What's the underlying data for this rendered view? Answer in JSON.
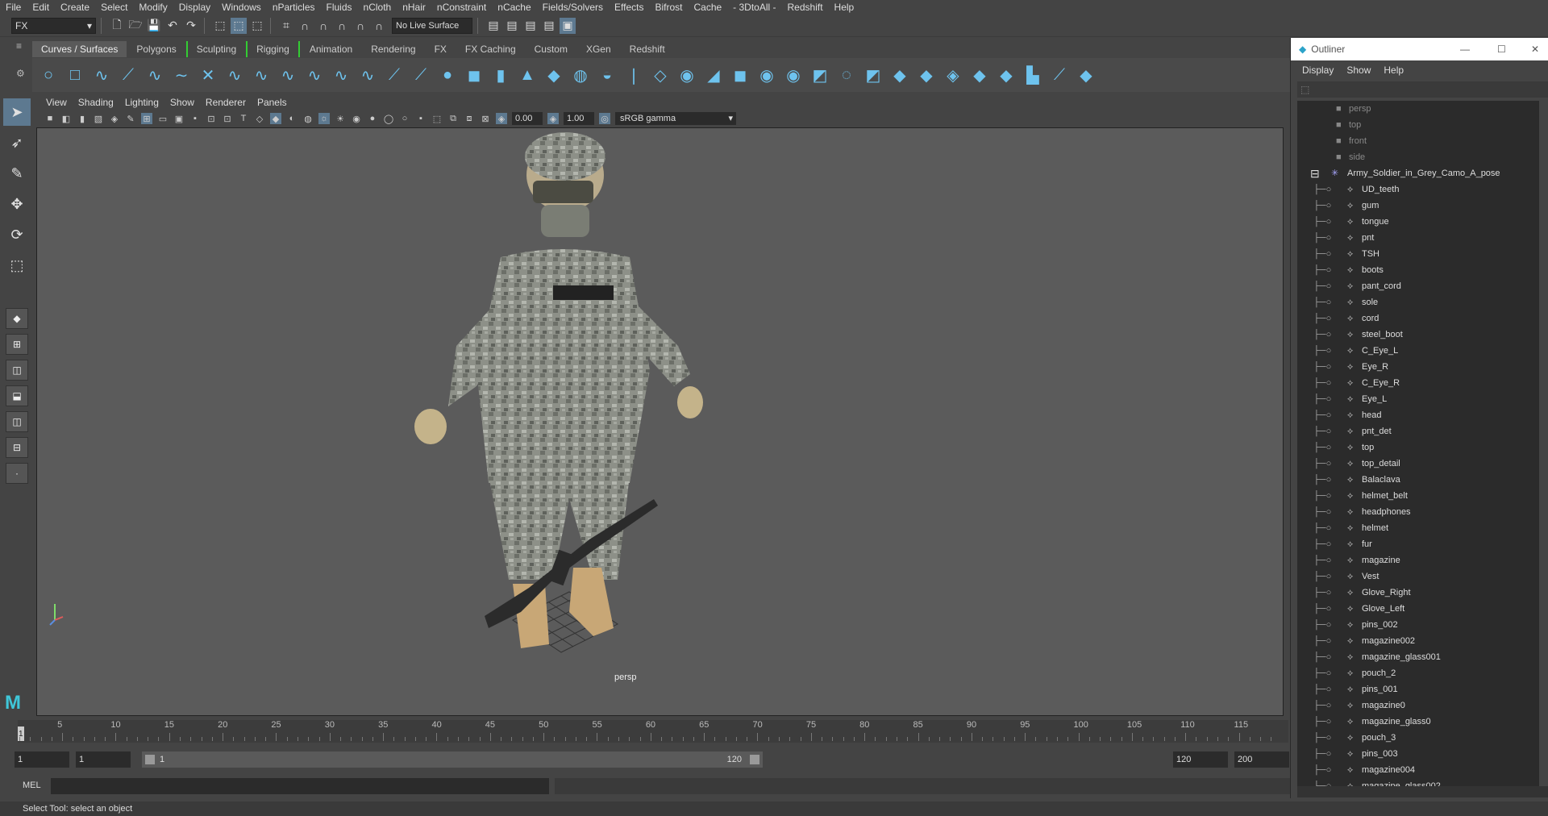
{
  "menubar": [
    "File",
    "Edit",
    "Create",
    "Select",
    "Modify",
    "Display",
    "Windows",
    "nParticles",
    "Fluids",
    "nCloth",
    "nHair",
    "nConstraint",
    "nCache",
    "Fields/Solvers",
    "Effects",
    "Bifrost",
    "Cache",
    "- 3DtoAll -",
    "Redshift",
    "Help"
  ],
  "statusline": {
    "mode": "FX",
    "live_surface": "No Live Surface"
  },
  "shelf_tabs": [
    "Curves / Surfaces",
    "Polygons",
    "Sculpting",
    "Rigging",
    "Animation",
    "Rendering",
    "FX",
    "FX Caching",
    "Custom",
    "XGen",
    "Redshift"
  ],
  "panel_menu": [
    "View",
    "Shading",
    "Lighting",
    "Show",
    "Renderer",
    "Panels"
  ],
  "panel_toolbar": {
    "exposure": "0.00",
    "gamma_value": "1.00",
    "color_space": "sRGB gamma"
  },
  "viewport": {
    "camera": "persp"
  },
  "timeline": {
    "ticks": [
      "5",
      "10",
      "15",
      "20",
      "25",
      "30",
      "35",
      "40",
      "45",
      "50",
      "55",
      "60",
      "65",
      "70",
      "75",
      "80",
      "85",
      "90",
      "95",
      "100",
      "105",
      "110",
      "115"
    ],
    "current_frame": "1"
  },
  "range": {
    "start": "1",
    "current": "1",
    "slider_start": "1",
    "slider_end": "120",
    "end": "120",
    "max": "200"
  },
  "cmdline": {
    "label": "MEL"
  },
  "helpline": "Select Tool: select an object",
  "outliner": {
    "title": "Outliner",
    "menu": [
      "Display",
      "Show",
      "Help"
    ],
    "cameras": [
      "persp",
      "top",
      "front",
      "side"
    ],
    "group": "Army_Soldier_in_Grey_Camo_A_pose",
    "children": [
      "UD_teeth",
      "gum",
      "tongue",
      "pnt",
      "TSH",
      "boots",
      "pant_cord",
      "sole",
      "cord",
      "steel_boot",
      "C_Eye_L",
      "Eye_R",
      "C_Eye_R",
      "Eye_L",
      "head",
      "pnt_det",
      "top",
      "top_detail",
      "Balaclava",
      "helmet_belt",
      "headphones",
      "helmet",
      "fur",
      "magazine",
      "Vest",
      "Glove_Right",
      "Glove_Left",
      "pins_002",
      "magazine002",
      "magazine_glass001",
      "pouch_2",
      "pins_001",
      "magazine0",
      "magazine_glass0",
      "pouch_3",
      "pins_003",
      "magazine004",
      "magazine_glass002"
    ]
  }
}
